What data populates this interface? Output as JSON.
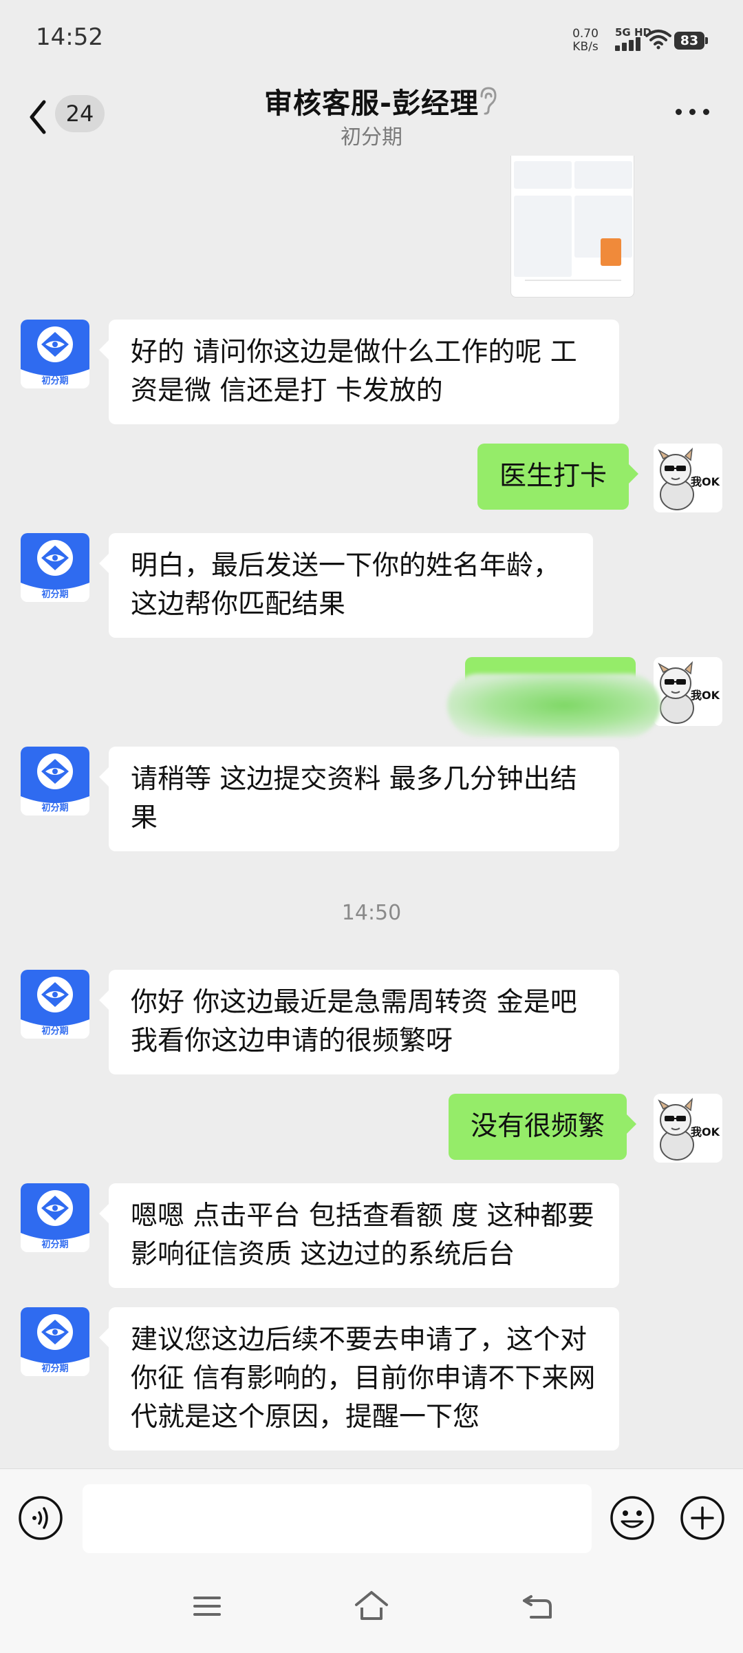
{
  "status_bar": {
    "time": "14:52",
    "net_speed_value": "0.70",
    "net_speed_unit": "KB/s",
    "signal_label": "5G HD",
    "battery": "83"
  },
  "header": {
    "unread_count": "24",
    "title": "审核客服-彭经理",
    "subtitle": "初分期"
  },
  "avatar": {
    "agent_label": "初分期",
    "self_label": "我OK"
  },
  "messages": [
    {
      "side": "left",
      "text": "好的 请问你这边是做什么工作的呢 工资是微 信还是打 卡发放的"
    },
    {
      "side": "right",
      "text": "医生打卡"
    },
    {
      "side": "left",
      "text": "明白，最后发送一下你的姓名年龄，这边帮你匹配结果"
    },
    {
      "side": "right",
      "text": ""
    },
    {
      "side": "left",
      "text": "请稍等  这边提交资料  最多几分钟出结果"
    },
    {
      "side": "left",
      "text": "你好  你这边最近是急需周转资 金是吧   我看你这边申请的很频繁呀"
    },
    {
      "side": "right",
      "text": "没有很频繁"
    },
    {
      "side": "left",
      "text": "嗯嗯 点击平台 包括查看额 度 这种都要影响征信资质 这边过的系统后台"
    },
    {
      "side": "left",
      "text": "建议您这边后续不要去申请了，这个对你征 信有影响的，目前你申请不下来网代就是这个原因，提醒一下您"
    }
  ],
  "timestamp": "14:50",
  "input": {
    "placeholder": ""
  },
  "colors": {
    "bubble_self": "#95ec69",
    "bubble_other": "#ffffff",
    "background": "#ededed",
    "brand_blue": "#2f6bf0"
  }
}
